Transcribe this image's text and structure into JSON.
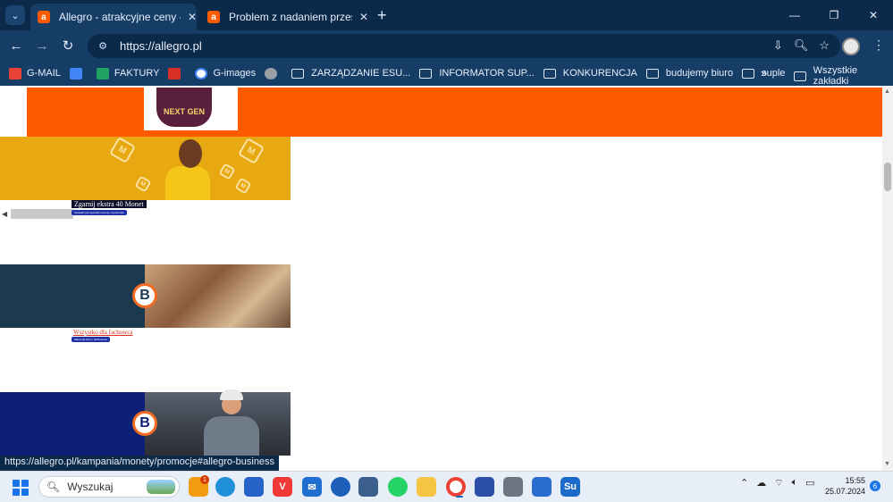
{
  "browser": {
    "tabs": [
      {
        "title": "Allegro - atrakcyjne ceny - Strona",
        "favicon": "allegro-icon",
        "active": true
      },
      {
        "title": "Problem z nadaniem przesyłki -",
        "favicon": "allegro-icon",
        "active": false
      }
    ],
    "new_tab_glyph": "+",
    "window_controls": {
      "minimize": "—",
      "restore": "❐",
      "close": "✕"
    },
    "url": "https://allegro.pl",
    "nav_glyphs": {
      "back": "←",
      "forward": "→",
      "reload": "↻"
    }
  },
  "bookmarks": {
    "items": [
      {
        "label": "G-MAIL",
        "icon": "gmail-icon",
        "color": "#ea4335"
      },
      {
        "label": "",
        "icon": "translate-icon",
        "color": "#4285f4"
      },
      {
        "label": "FAKTURY",
        "icon": "sheets-icon",
        "color": "#1ea362"
      },
      {
        "label": "",
        "icon": "red-m-icon",
        "color": "#d93025"
      },
      {
        "label": "G-images",
        "icon": "google-icon",
        "color": "#4285f4"
      },
      {
        "label": "",
        "icon": "settings-icon",
        "color": "#9aa0a6"
      },
      {
        "label": "ZARZĄDZANIE ESU...",
        "icon": "folder-icon"
      },
      {
        "label": "INFORMATOR SUP...",
        "icon": "folder-icon"
      },
      {
        "label": "KONKURENCJA",
        "icon": "folder-icon"
      },
      {
        "label": "budujemy biuro",
        "icon": "folder-icon"
      },
      {
        "label": "suple",
        "icon": "folder-icon"
      }
    ],
    "overflow_glyph": "»",
    "all_bookmarks": "Wszystkie zakładki"
  },
  "page": {
    "product_text": "NEXT GEN",
    "promo1_label": "Zgarnij ekstra 40 Monet",
    "promo1_sub": "Sprawdź jak zgarniać monety i wymieniać",
    "promo2_label": "Wszystko dla fachowca",
    "promo2_sub": "Sklep dla firmy i fachowców",
    "coin_letter": "M",
    "business_letter": "B"
  },
  "status_bar": {
    "url": "https://allegro.pl/kampania/monety/promocje#allegro-business"
  },
  "taskbar": {
    "search_placeholder": "Wyszukaj",
    "notification_count": "1",
    "time": "15:55",
    "date": "25.07.2024",
    "tray_badge": "6"
  }
}
